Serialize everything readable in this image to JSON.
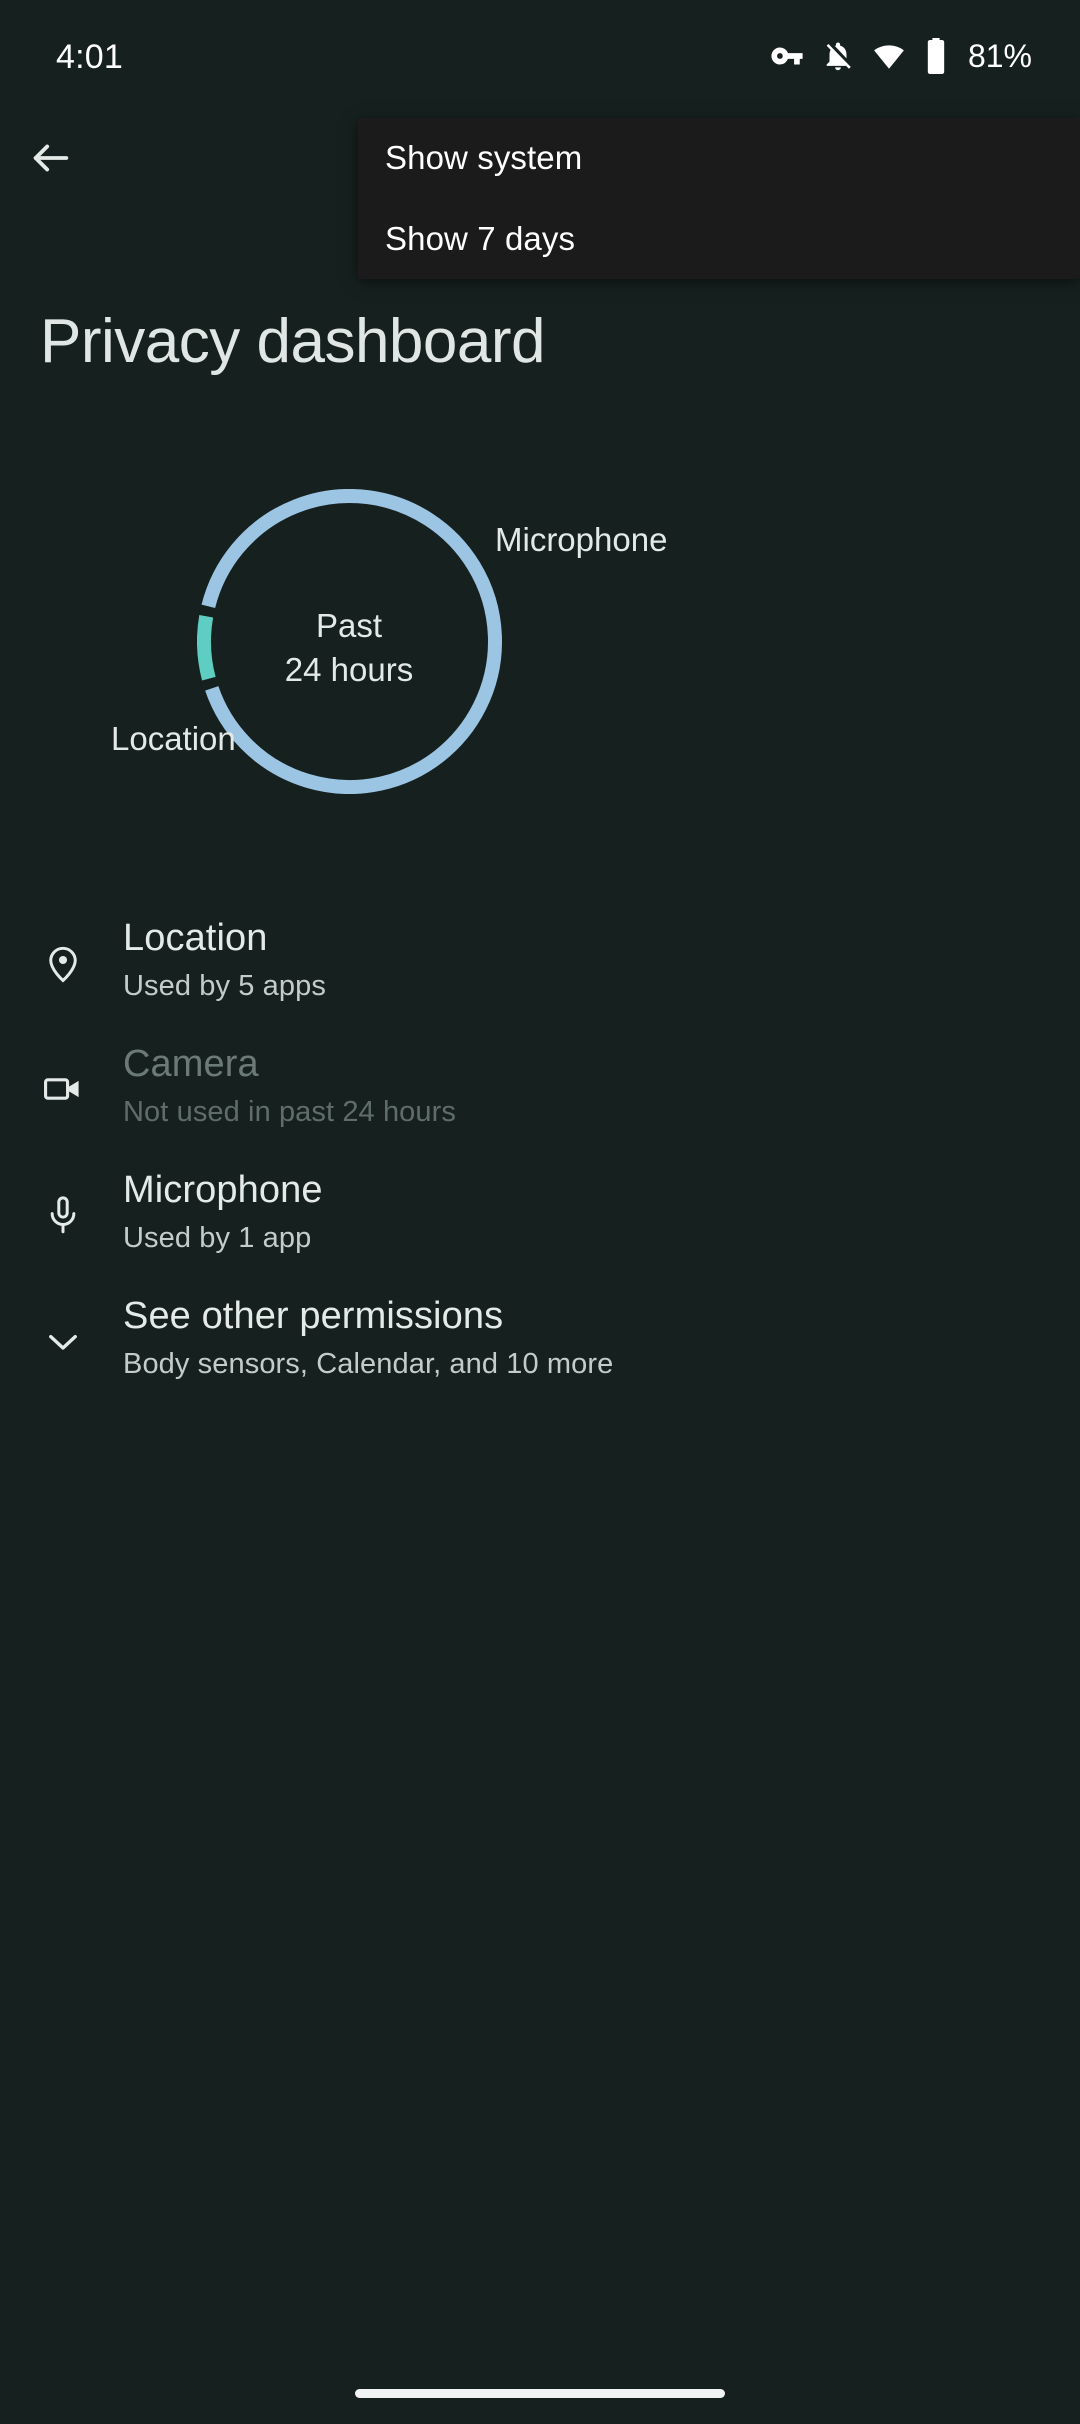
{
  "status_bar": {
    "time": "4:01",
    "battery_percent": "81%",
    "icons": [
      "vpn-key-icon",
      "notifications-off-icon",
      "wifi-icon",
      "battery-icon"
    ]
  },
  "overflow_menu": {
    "items": [
      {
        "label": "Show system"
      },
      {
        "label": "Show 7 days"
      }
    ]
  },
  "app_bar": {
    "back_icon": "arrow-back-icon",
    "title": "Privacy dashboard"
  },
  "chart_data": {
    "type": "pie",
    "title": "Past 24 hours",
    "center_line1": "Past",
    "center_line2": "24 hours",
    "categories": [
      "Location",
      "Microphone"
    ],
    "values": [
      92,
      8
    ],
    "colors": [
      "#9CC5E3",
      "#5FCEC2"
    ],
    "labels": [
      {
        "name": "Location",
        "text": "Location"
      },
      {
        "name": "Microphone",
        "text": "Microphone"
      }
    ],
    "legend": "inline-labels",
    "grid": false
  },
  "permission_list": [
    {
      "icon": "location-pin-icon",
      "title": "Location",
      "subtitle": "Used by 5 apps",
      "dimmed": false
    },
    {
      "icon": "videocam-icon",
      "title": "Camera",
      "subtitle": "Not used in past 24 hours",
      "dimmed": true
    },
    {
      "icon": "microphone-icon",
      "title": "Microphone",
      "subtitle": "Used by 1 app",
      "dimmed": false
    },
    {
      "icon": "chevron-down-icon",
      "title": "See other permissions",
      "subtitle": "Body sensors, Calendar, and 10 more",
      "dimmed": false
    }
  ],
  "theme": {
    "background": "#16211F",
    "menu_background": "#1B1B1B",
    "text_primary": "#E4EAE7",
    "text_secondary": "#C3CCC9",
    "text_disabled": "#6C7A77",
    "accent_location": "#9CC5E3",
    "accent_microphone": "#5FCEC2"
  }
}
